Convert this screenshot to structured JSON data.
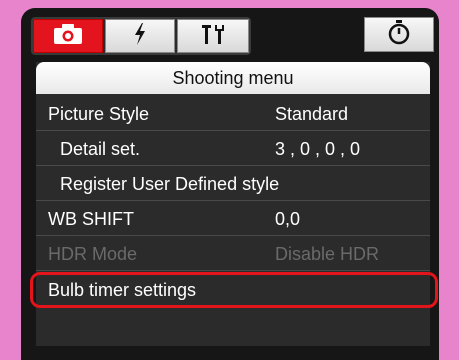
{
  "tabs": {
    "shooting": "camera-icon",
    "flash": "flash-icon",
    "tools": "tools-icon",
    "timer": "timer-icon"
  },
  "menu": {
    "title": "Shooting menu",
    "items": [
      {
        "label": "Picture Style",
        "value": "Standard"
      },
      {
        "label": "Detail set.",
        "value": "3 , 0 , 0 , 0"
      },
      {
        "label": "Register User Defined style",
        "value": ""
      },
      {
        "label": "WB SHIFT",
        "value": "0,0"
      },
      {
        "label": "HDR Mode",
        "value": "Disable HDR"
      },
      {
        "label": "Bulb timer settings",
        "value": ""
      }
    ]
  },
  "colors": {
    "accent": "#e4141e",
    "frame": "#e884cc",
    "background": "#161616"
  }
}
